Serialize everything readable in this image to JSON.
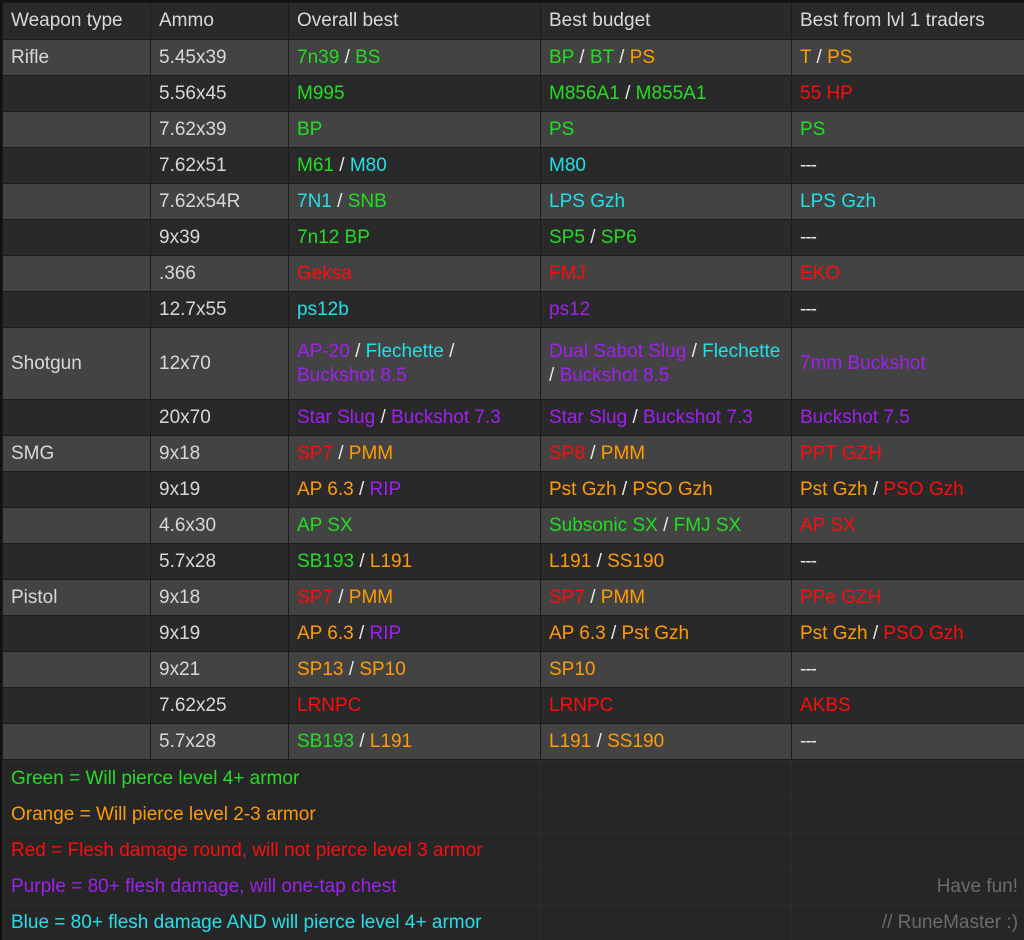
{
  "table": {
    "columns": [
      "Weapon type",
      "Ammo",
      "Overall best",
      "Best budget",
      "Best from lvl 1 traders"
    ],
    "rows": [
      {
        "weapon": "Rifle",
        "ammo": "5.45x39",
        "best": [
          {
            "t": "7n39",
            "c": "g"
          },
          {
            "t": "/",
            "c": "sep"
          },
          {
            "t": "BS",
            "c": "g"
          }
        ],
        "budget": [
          {
            "t": "BP",
            "c": "g"
          },
          {
            "t": "/",
            "c": "sep"
          },
          {
            "t": "BT",
            "c": "g"
          },
          {
            "t": "/",
            "c": "sep"
          },
          {
            "t": "PS",
            "c": "o"
          }
        ],
        "lvl1": [
          {
            "t": "T",
            "c": "o"
          },
          {
            "t": "/",
            "c": "sep"
          },
          {
            "t": "PS",
            "c": "o"
          }
        ]
      },
      {
        "weapon": "",
        "ammo": "5.56x45",
        "best": [
          {
            "t": "M995",
            "c": "g"
          }
        ],
        "budget": [
          {
            "t": "M856A1",
            "c": "g"
          },
          {
            "t": "/",
            "c": "sep"
          },
          {
            "t": "M855A1",
            "c": "g"
          }
        ],
        "lvl1": [
          {
            "t": "55 HP",
            "c": "r"
          }
        ]
      },
      {
        "weapon": "",
        "ammo": "7.62x39",
        "best": [
          {
            "t": "BP",
            "c": "g"
          }
        ],
        "budget": [
          {
            "t": "PS",
            "c": "g"
          }
        ],
        "lvl1": [
          {
            "t": "PS",
            "c": "g"
          }
        ]
      },
      {
        "weapon": "",
        "ammo": "7.62x51",
        "best": [
          {
            "t": "M61",
            "c": "g"
          },
          {
            "t": "/",
            "c": "sep"
          },
          {
            "t": "M80",
            "c": "b"
          }
        ],
        "budget": [
          {
            "t": "M80",
            "c": "b"
          }
        ],
        "lvl1": [
          {
            "t": "---",
            "c": "dash"
          }
        ]
      },
      {
        "weapon": "",
        "ammo": "7.62x54R",
        "best": [
          {
            "t": "7N1",
            "c": "b"
          },
          {
            "t": "/",
            "c": "sep"
          },
          {
            "t": "SNB",
            "c": "g"
          }
        ],
        "budget": [
          {
            "t": "LPS Gzh",
            "c": "b"
          }
        ],
        "lvl1": [
          {
            "t": "LPS Gzh",
            "c": "b"
          }
        ]
      },
      {
        "weapon": "",
        "ammo": "9x39",
        "best": [
          {
            "t": "7n12 BP",
            "c": "g"
          }
        ],
        "budget": [
          {
            "t": "SP5",
            "c": "g"
          },
          {
            "t": "/",
            "c": "sep"
          },
          {
            "t": "SP6",
            "c": "g"
          }
        ],
        "lvl1": [
          {
            "t": "---",
            "c": "dash"
          }
        ]
      },
      {
        "weapon": "",
        "ammo": ".366",
        "best": [
          {
            "t": "Geksa",
            "c": "r"
          }
        ],
        "budget": [
          {
            "t": "FMJ",
            "c": "r"
          }
        ],
        "lvl1": [
          {
            "t": "EKO",
            "c": "r"
          }
        ]
      },
      {
        "weapon": "",
        "ammo": "12.7x55",
        "best": [
          {
            "t": "ps12b",
            "c": "b"
          }
        ],
        "budget": [
          {
            "t": "ps12",
            "c": "p"
          }
        ],
        "lvl1": [
          {
            "t": "---",
            "c": "dash"
          }
        ]
      },
      {
        "weapon": "Shotgun",
        "ammo": "12x70",
        "tall": true,
        "best": [
          {
            "t": "AP-20",
            "c": "p"
          },
          {
            "t": "/",
            "c": "sep"
          },
          {
            "t": "Flechette",
            "c": "b"
          },
          {
            "t": "/",
            "c": "sep"
          },
          {
            "t": "Buckshot 8.5",
            "c": "p"
          }
        ],
        "budget": [
          {
            "t": "Dual Sabot Slug",
            "c": "p"
          },
          {
            "t": "/",
            "c": "sep"
          },
          {
            "t": "Flechette",
            "c": "b"
          },
          {
            "t": "/",
            "c": "sep"
          },
          {
            "t": "Buckshot 8.5",
            "c": "p"
          }
        ],
        "lvl1": [
          {
            "t": "7mm Buckshot",
            "c": "p"
          }
        ]
      },
      {
        "weapon": "",
        "ammo": "20x70",
        "best": [
          {
            "t": "Star Slug",
            "c": "p"
          },
          {
            "t": "/",
            "c": "sep"
          },
          {
            "t": "Buckshot 7.3",
            "c": "p"
          }
        ],
        "budget": [
          {
            "t": "Star Slug",
            "c": "p"
          },
          {
            "t": "/",
            "c": "sep"
          },
          {
            "t": "Buckshot 7.3",
            "c": "p"
          }
        ],
        "lvl1": [
          {
            "t": "Buckshot 7.5",
            "c": "p"
          }
        ]
      },
      {
        "weapon": "SMG",
        "ammo": "9x18",
        "best": [
          {
            "t": "SP7",
            "c": "r"
          },
          {
            "t": "/",
            "c": "sep"
          },
          {
            "t": "PMM",
            "c": "o"
          }
        ],
        "budget": [
          {
            "t": "SP8",
            "c": "r"
          },
          {
            "t": "/",
            "c": "sep"
          },
          {
            "t": "PMM",
            "c": "o"
          }
        ],
        "lvl1": [
          {
            "t": "PPT GZH",
            "c": "r"
          }
        ]
      },
      {
        "weapon": "",
        "ammo": "9x19",
        "best": [
          {
            "t": "AP 6.3",
            "c": "o"
          },
          {
            "t": "/",
            "c": "sep"
          },
          {
            "t": "RIP",
            "c": "p"
          }
        ],
        "budget": [
          {
            "t": "Pst Gzh",
            "c": "o"
          },
          {
            "t": "/",
            "c": "sep"
          },
          {
            "t": "PSO Gzh",
            "c": "o"
          }
        ],
        "lvl1": [
          {
            "t": "Pst Gzh",
            "c": "o"
          },
          {
            "t": "/",
            "c": "sep"
          },
          {
            "t": "PSO Gzh",
            "c": "r"
          }
        ]
      },
      {
        "weapon": "",
        "ammo": "4.6x30",
        "best": [
          {
            "t": "AP SX",
            "c": "g"
          }
        ],
        "budget": [
          {
            "t": "Subsonic SX",
            "c": "g"
          },
          {
            "t": "/",
            "c": "sep"
          },
          {
            "t": "FMJ SX",
            "c": "g"
          }
        ],
        "lvl1": [
          {
            "t": "AP SX",
            "c": "r"
          }
        ]
      },
      {
        "weapon": "",
        "ammo": "5.7x28",
        "best": [
          {
            "t": "SB193",
            "c": "g"
          },
          {
            "t": "/",
            "c": "sep"
          },
          {
            "t": "L191",
            "c": "o"
          }
        ],
        "budget": [
          {
            "t": "L191",
            "c": "o"
          },
          {
            "t": "/",
            "c": "sep"
          },
          {
            "t": "SS190",
            "c": "o"
          }
        ],
        "lvl1": [
          {
            "t": "---",
            "c": "dash"
          }
        ]
      },
      {
        "weapon": "Pistol",
        "ammo": "9x18",
        "best": [
          {
            "t": "SP7",
            "c": "r"
          },
          {
            "t": "/",
            "c": "sep"
          },
          {
            "t": "PMM",
            "c": "o"
          }
        ],
        "budget": [
          {
            "t": "SP7",
            "c": "r"
          },
          {
            "t": "/",
            "c": "sep"
          },
          {
            "t": "PMM",
            "c": "o"
          }
        ],
        "lvl1": [
          {
            "t": "PPe GZH",
            "c": "r"
          }
        ]
      },
      {
        "weapon": "",
        "ammo": "9x19",
        "best": [
          {
            "t": "AP 6.3",
            "c": "o"
          },
          {
            "t": "/",
            "c": "sep"
          },
          {
            "t": "RIP",
            "c": "p"
          }
        ],
        "budget": [
          {
            "t": "AP 6.3",
            "c": "o"
          },
          {
            "t": "/",
            "c": "sep"
          },
          {
            "t": "Pst Gzh",
            "c": "o"
          }
        ],
        "lvl1": [
          {
            "t": "Pst Gzh",
            "c": "o"
          },
          {
            "t": "/",
            "c": "sep"
          },
          {
            "t": "PSO Gzh",
            "c": "r"
          }
        ]
      },
      {
        "weapon": "",
        "ammo": "9x21",
        "best": [
          {
            "t": "SP13",
            "c": "o"
          },
          {
            "t": "/",
            "c": "sep"
          },
          {
            "t": "SP10",
            "c": "o"
          }
        ],
        "budget": [
          {
            "t": "SP10",
            "c": "o"
          }
        ],
        "lvl1": [
          {
            "t": "---",
            "c": "dash"
          }
        ]
      },
      {
        "weapon": "",
        "ammo": "7.62x25",
        "best": [
          {
            "t": "LRNPC",
            "c": "r"
          }
        ],
        "budget": [
          {
            "t": "LRNPC",
            "c": "r"
          }
        ],
        "lvl1": [
          {
            "t": "AKBS",
            "c": "r"
          }
        ]
      },
      {
        "weapon": "",
        "ammo": "5.7x28",
        "best": [
          {
            "t": "SB193",
            "c": "g"
          },
          {
            "t": "/",
            "c": "sep"
          },
          {
            "t": "L191",
            "c": "o"
          }
        ],
        "budget": [
          {
            "t": "L191",
            "c": "o"
          },
          {
            "t": "/",
            "c": "sep"
          },
          {
            "t": "SS190",
            "c": "o"
          }
        ],
        "lvl1": [
          {
            "t": "---",
            "c": "dash"
          }
        ]
      }
    ]
  },
  "legend": {
    "lines": [
      {
        "text": "Green = Will pierce level 4+ armor",
        "color": "g"
      },
      {
        "text": "Orange = Will pierce level 2-3 armor",
        "color": "o"
      },
      {
        "text": "Red = Flesh damage round, will not pierce level 3 armor",
        "color": "r"
      },
      {
        "text": "Purple = 80+ flesh damage, will one-tap chest",
        "color": "p"
      },
      {
        "text": "Blue = 80+ flesh damage AND will pierce level 4+ armor",
        "color": "b"
      }
    ],
    "signoff_1": "Have fun!",
    "signoff_2": "// RuneMaster :)"
  },
  "colors": {
    "green": "#22dd22",
    "orange": "#ff9c00",
    "red": "#fb0d0d",
    "purple": "#a020f0",
    "blue": "#22e0e8",
    "text": "#d8d8d8",
    "signoff": "#6b6b6b",
    "row_dark": "#292929",
    "row_light": "#434343",
    "legend_bg": "#262626"
  }
}
